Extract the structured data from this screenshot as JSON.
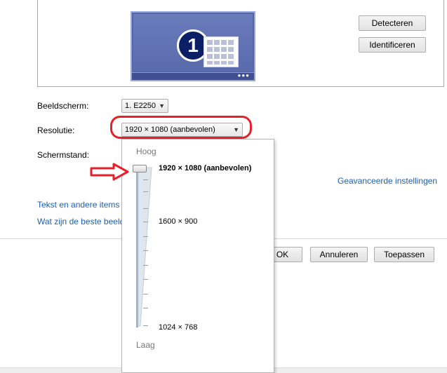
{
  "buttons": {
    "detect": "Detecteren",
    "identify": "Identificeren",
    "ok": "OK",
    "cancel": "Annuleren",
    "apply": "Toepassen"
  },
  "monitor": {
    "number": "1",
    "taskbar_dots": "●●●"
  },
  "display": {
    "label": "Beeldscherm:",
    "value": "1. E2250"
  },
  "resolution": {
    "label": "Resolutie:",
    "value": "1920 × 1080 (aanbevolen)"
  },
  "orientation": {
    "label": "Schermstand:"
  },
  "links": {
    "advanced": "Geavanceerde instellingen",
    "text_items": "Tekst en andere items g",
    "best_display": "Wat zijn de beste beeld"
  },
  "dropdown": {
    "high_label": "Hoog",
    "low_label": "Laag",
    "options": [
      {
        "label": "1920 × 1080 (aanbevolen)",
        "selected": true
      },
      {
        "label": "1600 × 900",
        "selected": false
      },
      {
        "label": "1024 × 768",
        "selected": false
      }
    ]
  },
  "colors": {
    "highlight": "#e8202a",
    "link": "#1e5fae",
    "monitor": "#5466a9"
  }
}
